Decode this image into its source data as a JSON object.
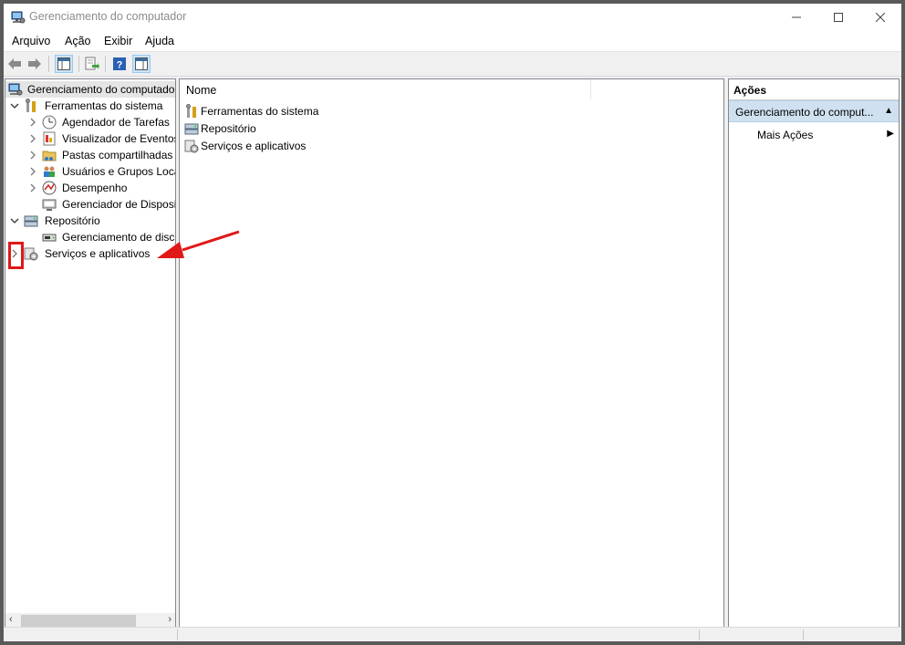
{
  "window": {
    "title": "Gerenciamento do computador"
  },
  "menu": [
    "Arquivo",
    "Ação",
    "Exibir",
    "Ajuda"
  ],
  "tree": {
    "root": "Gerenciamento do computador",
    "items": [
      {
        "label": "Ferramentas do sistema",
        "level": 1,
        "expander": "expanded",
        "icon": "tools-icon"
      },
      {
        "label": "Agendador de Tarefas",
        "level": 2,
        "expander": "collapsed",
        "icon": "clock-icon"
      },
      {
        "label": "Visualizador de Eventos",
        "level": 2,
        "expander": "collapsed",
        "icon": "event-viewer-icon"
      },
      {
        "label": "Pastas compartilhadas",
        "level": 2,
        "expander": "collapsed",
        "icon": "shared-folder-icon"
      },
      {
        "label": "Usuários e Grupos Loca",
        "level": 2,
        "expander": "collapsed",
        "icon": "users-icon"
      },
      {
        "label": "Desempenho",
        "level": 2,
        "expander": "collapsed",
        "icon": "performance-icon"
      },
      {
        "label": "Gerenciador de Disposit",
        "level": 2,
        "expander": "none",
        "icon": "device-manager-icon"
      },
      {
        "label": "Repositório",
        "level": 1,
        "expander": "expanded",
        "icon": "storage-icon"
      },
      {
        "label": "Gerenciamento de disco",
        "level": 2,
        "expander": "none",
        "icon": "disk-icon"
      },
      {
        "label": "Serviços e aplicativos",
        "level": 1,
        "expander": "collapsed",
        "icon": "services-icon"
      }
    ]
  },
  "list": {
    "column": "Nome",
    "items": [
      {
        "label": "Ferramentas do sistema",
        "icon": "tools-icon"
      },
      {
        "label": "Repositório",
        "icon": "storage-icon"
      },
      {
        "label": "Serviços e aplicativos",
        "icon": "services-icon"
      }
    ]
  },
  "actions": {
    "header": "Ações",
    "selected": "Gerenciamento do comput...",
    "more": "Mais Ações"
  },
  "colors": {
    "highlight": "#e01818",
    "selection": "#cfe1f0"
  }
}
